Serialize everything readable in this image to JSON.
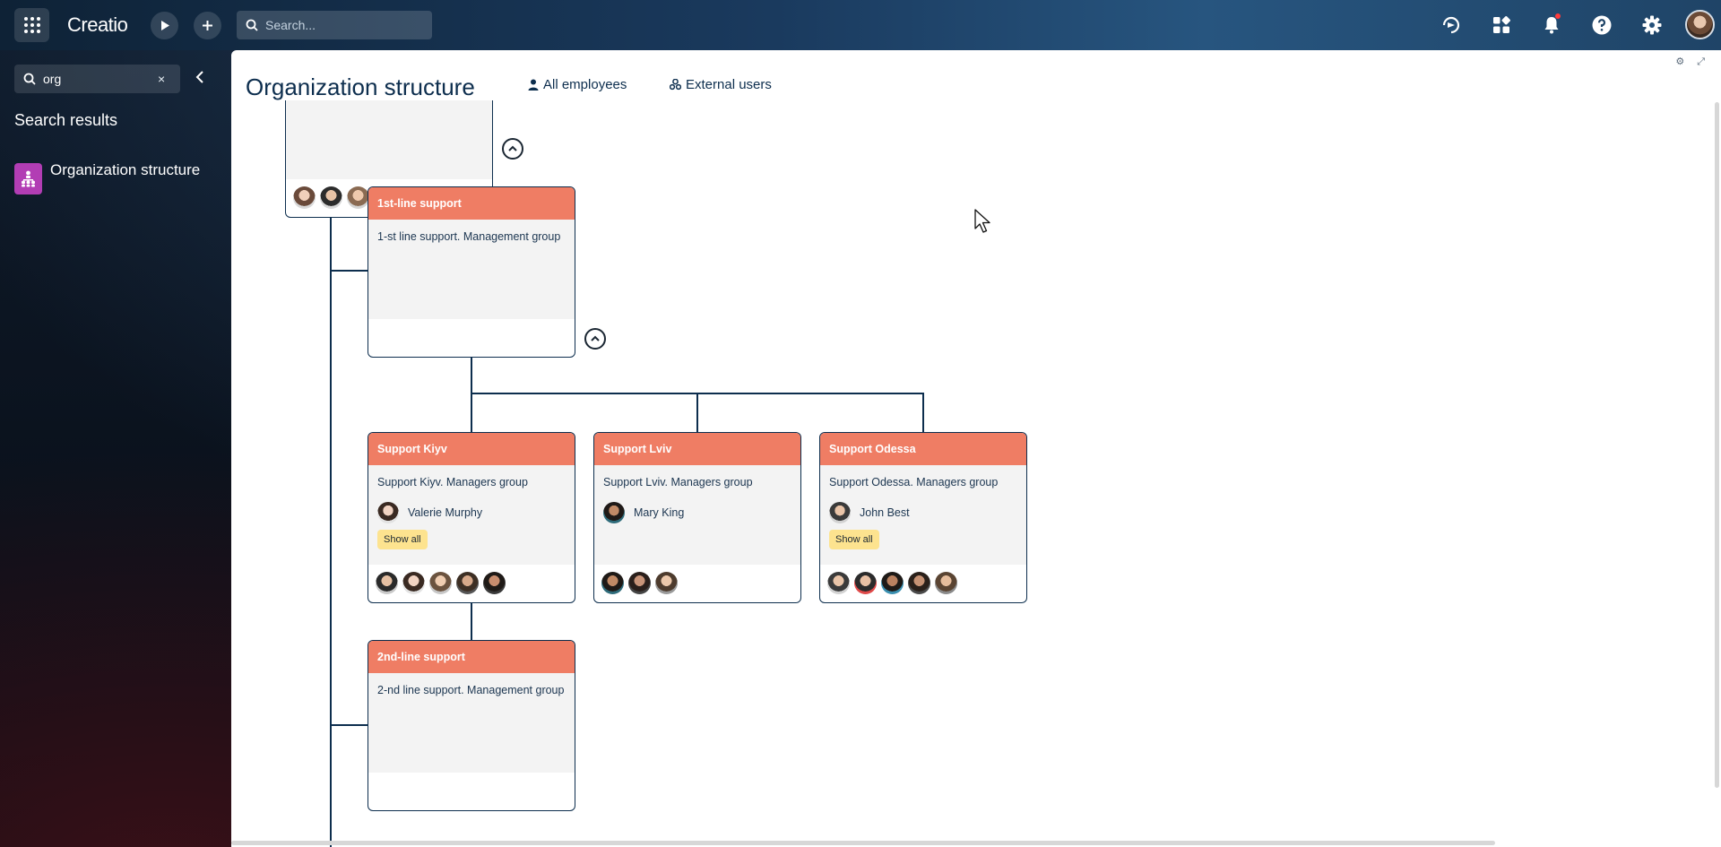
{
  "topbar": {
    "logo": "Creatio",
    "search_placeholder": "Search..."
  },
  "sidebar": {
    "search_value": "org",
    "clear_symbol": "×",
    "results_heading": "Search results",
    "results": [
      {
        "label": "Organization structure",
        "icon": "org-chart-icon",
        "icon_color": "#b23db4"
      }
    ]
  },
  "main": {
    "title": "Organization structure",
    "tabs": [
      {
        "label": "All employees",
        "icon": "person-icon"
      },
      {
        "label": "External users",
        "icon": "people-icon"
      }
    ]
  },
  "colors": {
    "card_header": "#ef7d64",
    "card_body": "#f3f3f3",
    "connector": "#0d2e4e",
    "show_all_bg": "#fde38f"
  },
  "org": {
    "show_all_label": "Show all",
    "units": [
      {
        "id": "first-line",
        "title": "1st-line support",
        "description": "1-st line support. Management group"
      },
      {
        "id": "kyiv",
        "title": "Support Kiyv",
        "description": "Support Kiyv. Managers group",
        "manager": "Valerie Murphy",
        "show_all": true
      },
      {
        "id": "lviv",
        "title": "Support Lviv",
        "description": "Support Lviv. Managers group",
        "manager": "Mary King",
        "show_all": false
      },
      {
        "id": "odessa",
        "title": "Support Odessa",
        "description": "Support Odessa. Managers group",
        "manager": "John Best",
        "show_all": true
      },
      {
        "id": "second-line",
        "title": "2nd-line support",
        "description": "2-nd line support. Management group"
      }
    ]
  }
}
